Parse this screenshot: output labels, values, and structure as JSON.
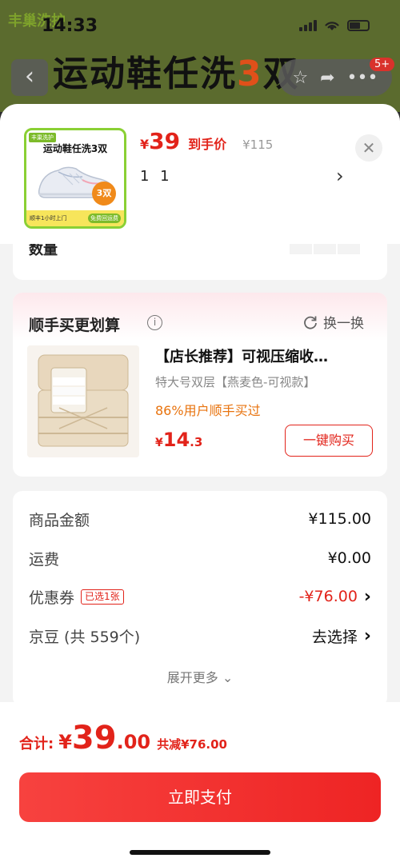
{
  "status_bar": {
    "time": "14:33"
  },
  "background": {
    "banner_logo": "丰巢洗护",
    "banner_title": "运动鞋任洗",
    "banner_title_num": "3",
    "banner_title_end": "双",
    "badge": "5+"
  },
  "product": {
    "thumb": {
      "logo": "丰巢洗护",
      "title": "运动鞋任洗3双",
      "badge": "3双",
      "foot_left": "顺丰1小时上门",
      "foot_right": "免费回运费"
    },
    "price_currency": "¥",
    "price_value": "39",
    "price_tag": "到手价",
    "original_price": "¥115",
    "spec": "1 1"
  },
  "quantity": {
    "label": "数量"
  },
  "upsell": {
    "title": "顺手买更划算",
    "swap_label": "换一换",
    "name": "【店长推荐】可视压缩收…",
    "spec": "特大号双层【燕麦色-可视款】",
    "rate": "86%用户顺手买过",
    "price_currency": "¥",
    "price_int": "14",
    "price_dec": ".3",
    "buy_label": "一键购买"
  },
  "summary": {
    "rows": [
      {
        "label": "商品金额",
        "value": "¥115.00"
      },
      {
        "label": "运费",
        "value": "¥0.00"
      },
      {
        "label": "优惠券",
        "badge": "已选1张",
        "value": "-¥76.00"
      },
      {
        "label": "京豆 (共 559个)",
        "value": "去选择"
      }
    ],
    "expand_label": "展开更多"
  },
  "footer": {
    "total_label": "合计:",
    "total_currency": "¥",
    "total_int": "39",
    "total_dec": ".00",
    "total_save": "共减¥76.00",
    "pay_label": "立即支付"
  },
  "colors": {
    "accent": "#e2231a",
    "rate": "#e8730e",
    "thumb_border": "#8ad034"
  }
}
